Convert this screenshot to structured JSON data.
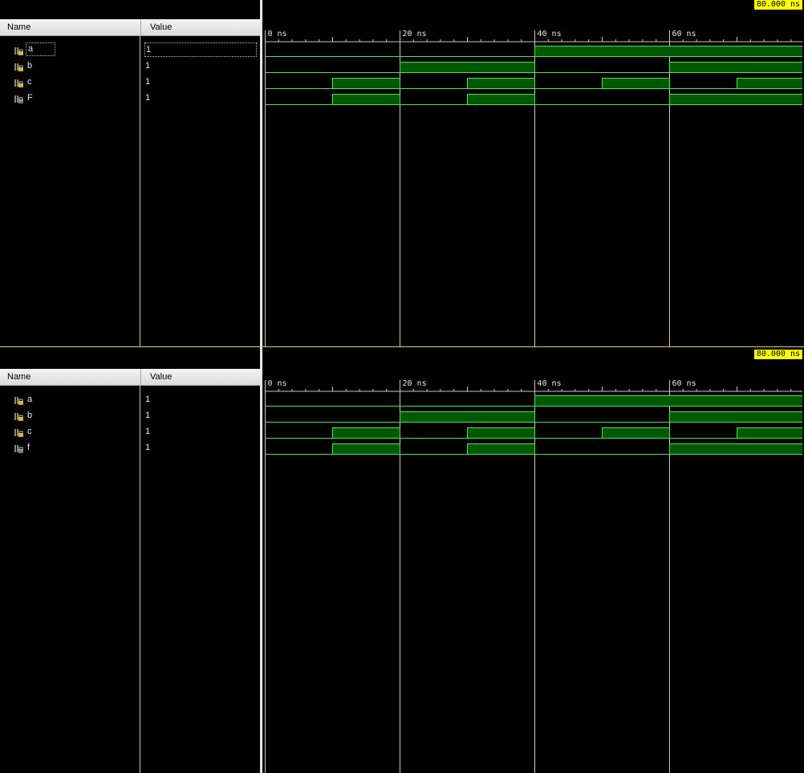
{
  "panes": [
    {
      "id": "top",
      "header": {
        "name": "Name",
        "value": "Value"
      },
      "cursor_label": "80.000 ns",
      "time_markers": [
        "0 ns",
        "20 ns",
        "40 ns",
        "60 ns"
      ],
      "signals": [
        {
          "name": "a",
          "value": "1",
          "kind": "input",
          "transitions": [
            [
              0,
              0
            ],
            [
              40,
              1
            ]
          ]
        },
        {
          "name": "b",
          "value": "1",
          "kind": "input",
          "transitions": [
            [
              0,
              0
            ],
            [
              20,
              1
            ],
            [
              40,
              0
            ],
            [
              60,
              1
            ]
          ]
        },
        {
          "name": "c",
          "value": "1",
          "kind": "input",
          "transitions": [
            [
              0,
              0
            ],
            [
              10,
              1
            ],
            [
              20,
              0
            ],
            [
              30,
              1
            ],
            [
              40,
              0
            ],
            [
              50,
              1
            ],
            [
              60,
              0
            ],
            [
              70,
              1
            ]
          ]
        },
        {
          "name": "F",
          "value": "1",
          "kind": "output",
          "transitions": [
            [
              0,
              0
            ],
            [
              10,
              1
            ],
            [
              20,
              0
            ],
            [
              30,
              1
            ],
            [
              40,
              0
            ],
            [
              60,
              1
            ]
          ]
        }
      ]
    },
    {
      "id": "bottom",
      "header": {
        "name": "Name",
        "value": "Value"
      },
      "cursor_label": "80.000 ns",
      "time_markers": [
        "0 ns",
        "20 ns",
        "40 ns",
        "60 ns"
      ],
      "signals": [
        {
          "name": "a",
          "value": "1",
          "kind": "input",
          "transitions": [
            [
              0,
              0
            ],
            [
              40,
              1
            ]
          ]
        },
        {
          "name": "b",
          "value": "1",
          "kind": "input",
          "transitions": [
            [
              0,
              0
            ],
            [
              20,
              1
            ],
            [
              40,
              0
            ],
            [
              60,
              1
            ]
          ]
        },
        {
          "name": "c",
          "value": "1",
          "kind": "input",
          "transitions": [
            [
              0,
              0
            ],
            [
              10,
              1
            ],
            [
              20,
              0
            ],
            [
              30,
              1
            ],
            [
              40,
              0
            ],
            [
              50,
              1
            ],
            [
              60,
              0
            ],
            [
              70,
              1
            ]
          ]
        },
        {
          "name": "f",
          "value": "1",
          "kind": "output",
          "transitions": [
            [
              0,
              0
            ],
            [
              10,
              1
            ],
            [
              20,
              0
            ],
            [
              30,
              1
            ],
            [
              40,
              0
            ],
            [
              60,
              1
            ]
          ]
        }
      ]
    }
  ],
  "time_range_ns": [
    0,
    80
  ],
  "colors": {
    "wave_line": "#4de64d",
    "wave_fill": "#005800",
    "grid_line": "#c8c8c8",
    "cursor_bg": "#ffff00"
  }
}
